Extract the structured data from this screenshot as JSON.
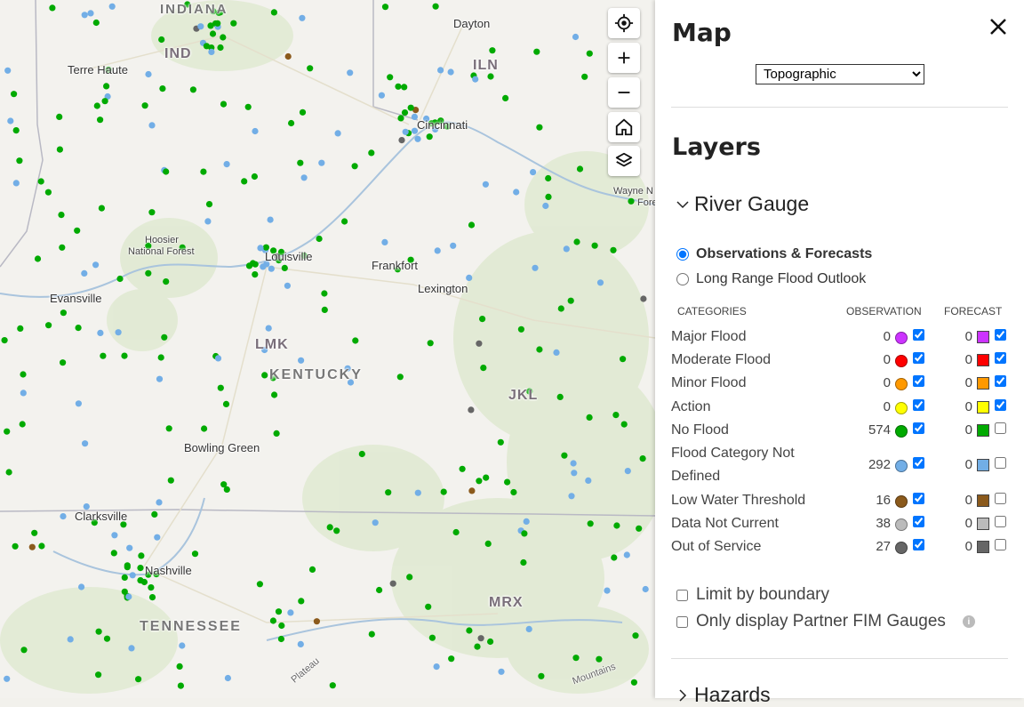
{
  "map": {
    "labels": {
      "indiana": "INDIANA",
      "ind": "IND",
      "terre_haute": "Terre Haute",
      "dayton": "Dayton",
      "iln": "ILN",
      "cincinnati": "Cincinnati",
      "wayne": "Wayne N",
      "forest": "Fore",
      "hoosier": "Hoosier",
      "national_forest": "National Forest",
      "louisville": "Louisville",
      "frankfort": "Frankfort",
      "lexington": "Lexington",
      "evansville": "Evansville",
      "lmk": "LMK",
      "kentucky": "KENTUCKY",
      "jkl": "JKL",
      "bowling_green": "Bowling Green",
      "clarksville": "Clarksville",
      "nashville": "Nashville",
      "tennessee": "TENNESSEE",
      "mrx": "MRX",
      "plateau": "Plateau",
      "mountains": "Mountains"
    },
    "controls": [
      "locate-icon",
      "zoom-in-icon",
      "zoom-out-icon",
      "home-icon",
      "layers-icon"
    ]
  },
  "panel": {
    "title": "Map",
    "basemap_selected": "Topographic",
    "layers_title": "Layers",
    "river_gauge": "River Gauge",
    "radio_options": [
      "Observations & Forecasts",
      "Long Range Flood Outlook"
    ],
    "col_categories": "CATEGORIES",
    "col_observation": "OBSERVATION",
    "col_forecast": "FORECAST",
    "categories": [
      {
        "label": "Major Flood",
        "obs": "0",
        "fc": "0",
        "color": "#cc33ff",
        "obs_checked": true,
        "fc_checked": true
      },
      {
        "label": "Moderate Flood",
        "obs": "0",
        "fc": "0",
        "color": "#ff0000",
        "obs_checked": true,
        "fc_checked": true
      },
      {
        "label": "Minor Flood",
        "obs": "0",
        "fc": "0",
        "color": "#ff9900",
        "obs_checked": true,
        "fc_checked": true
      },
      {
        "label": "Action",
        "obs": "0",
        "fc": "0",
        "color": "#ffff00",
        "obs_checked": true,
        "fc_checked": true
      },
      {
        "label": "No Flood",
        "obs": "574",
        "fc": "0",
        "color": "#00aa00",
        "obs_checked": true,
        "fc_checked": false
      },
      {
        "label": "Flood Category Not",
        "label2": "Defined",
        "obs": "292",
        "fc": "0",
        "color": "#72aee6",
        "obs_checked": true,
        "fc_checked": false
      },
      {
        "label": "Low Water Threshold",
        "obs": "16",
        "fc": "0",
        "color": "#8b5a1c",
        "obs_checked": true,
        "fc_checked": false
      },
      {
        "label": "Data Not Current",
        "obs": "38",
        "fc": "0",
        "color": "#bbbbbb",
        "obs_checked": true,
        "fc_checked": false
      },
      {
        "label": "Out of Service",
        "obs": "27",
        "fc": "0",
        "color": "#666666",
        "obs_checked": true,
        "fc_checked": false
      }
    ],
    "limit_by_boundary": "Limit by boundary",
    "partner_fim": "Only display Partner FIM Gauges",
    "hazards": "Hazards"
  }
}
